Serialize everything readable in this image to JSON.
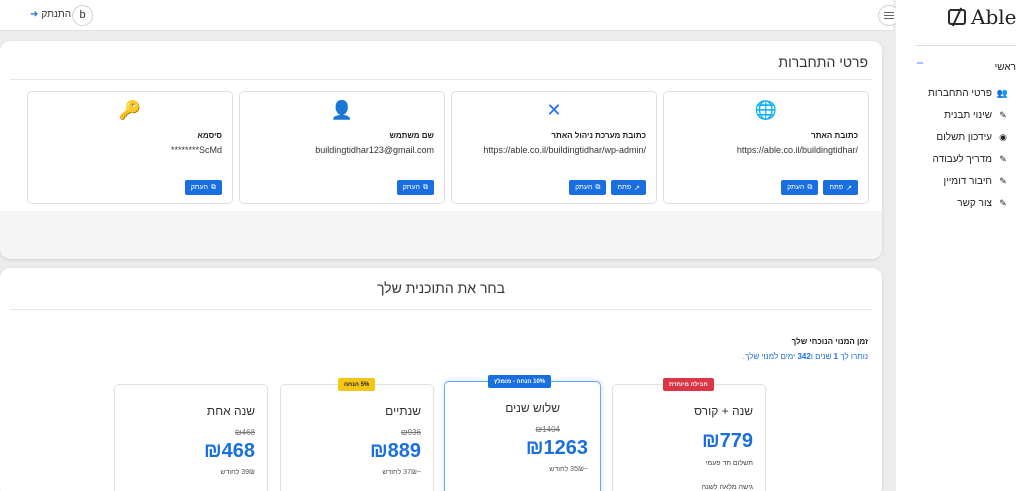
{
  "topbar": {
    "avatar_letter": "b",
    "logout_label": "התנתק"
  },
  "sidebar": {
    "logo_text": "Able",
    "home_label": "ראשי",
    "items": [
      {
        "label": "פרטי התחברות",
        "icon": "users-icon"
      },
      {
        "label": "שינוי תבנית",
        "icon": "edit-icon"
      },
      {
        "label": "עידכון תשלום",
        "icon": "eye-icon"
      },
      {
        "label": "מדריך לעבודה",
        "icon": "edit-icon"
      },
      {
        "label": "חיבור דומיין",
        "icon": "edit-icon"
      },
      {
        "label": "צור קשר",
        "icon": "edit-icon"
      }
    ]
  },
  "login_details": {
    "title": "פרטי התחברות",
    "cards": [
      {
        "icon": "globe-icon",
        "title": "כתובת האתר",
        "value": "https://able.co.il/buildingtidhar/",
        "open_label": "פתח",
        "copy_label": "העתק"
      },
      {
        "icon": "tools-icon",
        "title": "כתובת מערכת ניהול האתר",
        "value": "https://able.co.il/buildingtidhar/wp-admin/",
        "open_label": "פתח",
        "copy_label": "העתק"
      },
      {
        "icon": "user-icon",
        "title": "שם משתמש",
        "value": "buildingtidhar123@gmail.com",
        "copy_label": "העתק"
      },
      {
        "icon": "key-icon",
        "title": "סיסמא",
        "value": "********ScMd",
        "copy_label": "העתק"
      }
    ]
  },
  "plans": {
    "title": "בחר את התוכנית שלך",
    "current_label": "זמן המנוי הנוכחי שלך",
    "remaining_prefix": "נותרו לך",
    "remaining_years": "1",
    "remaining_mid": "שנים ו",
    "remaining_days": "342",
    "remaining_suffix": "ימים למנוי שלך.",
    "items": [
      {
        "name": "שנה + קורס",
        "badge": "חבילה מיוחדת",
        "badge_color": "#dc3545",
        "badge_text_color": "#ffffff",
        "old_price": "",
        "price": "₪779",
        "per_month": "",
        "note1": "תשלום חד פעמי",
        "note2": "גישה מלאה לשנה"
      },
      {
        "name": "שלוש שנים",
        "badge": "10% הנחה - מומלץ",
        "badge_color": "#1a6fe0",
        "badge_text_color": "#ffffff",
        "old_price": "₪1404",
        "price": "₪1263",
        "per_month": "~35₪ לחודש",
        "note1": "",
        "note2": ""
      },
      {
        "name": "שנתיים",
        "badge": "5% הנחה",
        "badge_color": "#f5c518",
        "badge_text_color": "#222222",
        "old_price": "₪936",
        "price": "₪889",
        "per_month": "~37₪ לחודש",
        "note1": "",
        "note2": ""
      },
      {
        "name": "שנה אחת",
        "badge": "",
        "badge_color": "",
        "badge_text_color": "",
        "old_price": "₪468",
        "price": "₪468",
        "per_month": "39₪ לחודש",
        "note1": "",
        "note2": ""
      }
    ]
  }
}
